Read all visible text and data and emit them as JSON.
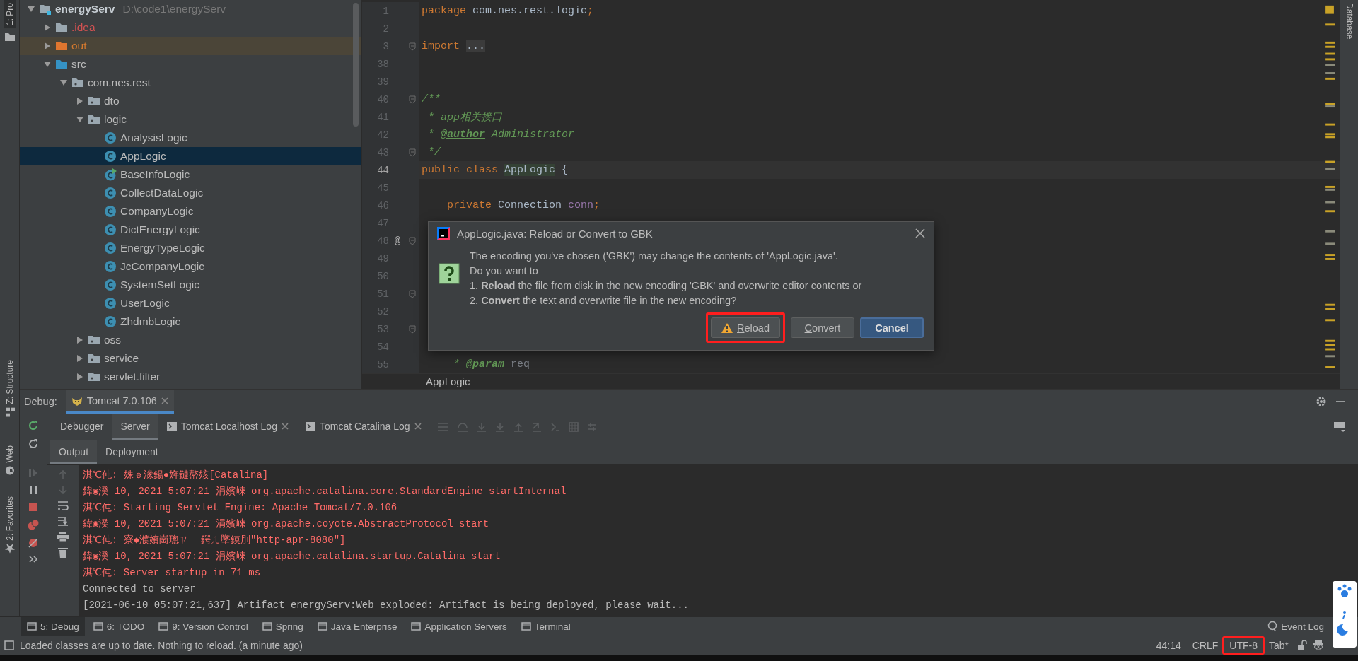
{
  "left_strip": {
    "tabs": [
      {
        "label": "1: Pro",
        "selected": true
      },
      {
        "label": "Z: Structure",
        "selected": false
      },
      {
        "label": "Web",
        "selected": false
      },
      {
        "label": "2: Favorites",
        "selected": false
      }
    ]
  },
  "project_tree": [
    {
      "label": "energyServ",
      "path": "D:\\code1\\energyServ",
      "kind": "module",
      "expanded": true,
      "selected": false,
      "children": [
        {
          "label": ".idea",
          "kind": "idea-folder",
          "expanded": false,
          "selected": false
        },
        {
          "label": "out",
          "kind": "excluded-folder",
          "expanded": false,
          "selected": false
        },
        {
          "label": "src",
          "kind": "source-folder",
          "expanded": true,
          "selected": false,
          "children": [
            {
              "label": "com.nes.rest",
              "kind": "package",
              "expanded": true,
              "selected": false,
              "children": [
                {
                  "label": "dto",
                  "kind": "package",
                  "expanded": false,
                  "selected": false
                },
                {
                  "label": "logic",
                  "kind": "package",
                  "expanded": true,
                  "selected": false,
                  "children": [
                    {
                      "label": "AnalysisLogic",
                      "kind": "class",
                      "selected": false
                    },
                    {
                      "label": "AppLogic",
                      "kind": "class",
                      "selected": true
                    },
                    {
                      "label": "BaseInfoLogic",
                      "kind": "runnable-class",
                      "selected": false
                    },
                    {
                      "label": "CollectDataLogic",
                      "kind": "class",
                      "selected": false
                    },
                    {
                      "label": "CompanyLogic",
                      "kind": "class",
                      "selected": false
                    },
                    {
                      "label": "DictEnergyLogic",
                      "kind": "class",
                      "selected": false
                    },
                    {
                      "label": "EnergyTypeLogic",
                      "kind": "class",
                      "selected": false
                    },
                    {
                      "label": "JcCompanyLogic",
                      "kind": "class",
                      "selected": false
                    },
                    {
                      "label": "SystemSetLogic",
                      "kind": "class",
                      "selected": false
                    },
                    {
                      "label": "UserLogic",
                      "kind": "class",
                      "selected": false
                    },
                    {
                      "label": "ZhdmbLogic",
                      "kind": "class",
                      "selected": false
                    }
                  ]
                },
                {
                  "label": "oss",
                  "kind": "package",
                  "expanded": false,
                  "selected": false
                },
                {
                  "label": "service",
                  "kind": "package",
                  "expanded": false,
                  "selected": false
                },
                {
                  "label": "servlet.filter",
                  "kind": "package",
                  "expanded": false,
                  "selected": false
                }
              ]
            }
          ]
        }
      ]
    }
  ],
  "editor": {
    "lines": [
      {
        "number": "1",
        "current": false,
        "fold": false,
        "tokens": [
          {
            "text": "package ",
            "kind": "keyword"
          },
          {
            "text": "com.nes.rest.logic",
            "kind": "plain"
          },
          {
            "text": ";",
            "kind": "keyword"
          }
        ]
      },
      {
        "number": "2",
        "current": false,
        "fold": false
      },
      {
        "number": "3",
        "current": false,
        "fold": true,
        "tokens": [
          {
            "text": "import ",
            "kind": "keyword"
          },
          {
            "text": "...",
            "kind": "folded"
          }
        ]
      },
      {
        "number": "38",
        "current": false,
        "fold": false
      },
      {
        "number": "39",
        "current": false,
        "fold": false
      },
      {
        "number": "40",
        "current": false,
        "fold": true,
        "tokens": [
          {
            "text": "/**",
            "kind": "comment"
          }
        ]
      },
      {
        "number": "41",
        "current": false,
        "fold": false,
        "tokens": [
          {
            "text": " * app相关接口",
            "kind": "comment"
          }
        ]
      },
      {
        "number": "42",
        "current": false,
        "fold": false,
        "tokens": [
          {
            "text": " * ",
            "kind": "comment"
          },
          {
            "text": "@author",
            "kind": "doc-tag"
          },
          {
            "text": " Administrator",
            "kind": "comment"
          }
        ]
      },
      {
        "number": "43",
        "current": false,
        "fold": true,
        "tokens": [
          {
            "text": " */",
            "kind": "comment"
          }
        ]
      },
      {
        "number": "44",
        "current": true,
        "fold": false,
        "tokens": [
          {
            "text": "public class ",
            "kind": "keyword"
          },
          {
            "text": "AppLogic",
            "kind": "declared"
          },
          {
            "text": " {",
            "kind": "plain"
          }
        ]
      },
      {
        "number": "45",
        "current": false,
        "fold": false
      },
      {
        "number": "46",
        "current": false,
        "fold": false,
        "tokens": [
          {
            "text": "    private ",
            "kind": "keyword"
          },
          {
            "text": "Connection ",
            "kind": "plain"
          },
          {
            "text": "conn",
            "kind": "field"
          },
          {
            "text": ";",
            "kind": "keyword"
          }
        ]
      },
      {
        "number": "47",
        "current": false,
        "fold": false
      },
      {
        "number": "48",
        "current": false,
        "fold": true,
        "marker": "@"
      },
      {
        "number": "49",
        "current": false,
        "fold": false
      },
      {
        "number": "50",
        "current": false,
        "fold": false
      },
      {
        "number": "51",
        "current": false,
        "fold": true
      },
      {
        "number": "52",
        "current": false,
        "fold": false
      },
      {
        "number": "53",
        "current": false,
        "fold": true
      },
      {
        "number": "54",
        "current": false,
        "fold": false
      },
      {
        "number": "55",
        "current": false,
        "fold": false,
        "tokens": [
          {
            "text": "     * ",
            "kind": "comment"
          },
          {
            "text": "@param",
            "kind": "doc-tag"
          },
          {
            "text": " req",
            "kind": "param"
          }
        ]
      }
    ],
    "breadcrumb": "AppLogic"
  },
  "right_strip": {
    "tabs": [
      {
        "label": "Database",
        "selected": false
      }
    ]
  },
  "dialog": {
    "title": "AppLogic.java: Reload or Convert to GBK",
    "message": [
      "The encoding you've chosen ('GBK') may change the contents of 'AppLogic.java'.",
      "Do you want to",
      "1. **Reload** the file from disk in the new encoding 'GBK' and overwrite editor contents or",
      "2. **Convert** the text and overwrite file in the new encoding?"
    ],
    "buttons": [
      {
        "label": "Reload",
        "kind": "warning",
        "mnemonic": true,
        "highlighted": true
      },
      {
        "label": "Convert",
        "kind": "normal",
        "mnemonic": true,
        "highlighted": false
      },
      {
        "label": "Cancel",
        "kind": "primary",
        "mnemonic": false,
        "highlighted": false
      }
    ]
  },
  "debug": {
    "title": "Debug:",
    "sessions": [
      {
        "label": "Tomcat 7.0.106",
        "selected": true
      }
    ],
    "tabs": [
      {
        "label": "Debugger",
        "selected": false,
        "kind": "plain"
      },
      {
        "label": "Server",
        "selected": true,
        "kind": "plain"
      },
      {
        "label": "Tomcat Localhost Log",
        "selected": false,
        "kind": "log"
      },
      {
        "label": "Tomcat Catalina Log",
        "selected": false,
        "kind": "log"
      }
    ],
    "subtabs": [
      {
        "label": "Output",
        "selected": true
      },
      {
        "label": "Deployment",
        "selected": false
      }
    ],
    "console": [
      {
        "text": "淇℃伅: 姝ｅ湪鍚●姩鏈嶅姟[Catalina]",
        "kind": "error"
      },
      {
        "text": "鍏◉湀 10, 2021 5:07:21 涓嬪崍 org.apache.catalina.core.StandardEngine startInternal",
        "kind": "error"
      },
      {
        "text": "淇℃伅: Starting Servlet Engine: Apache Tomcat/7.0.106",
        "kind": "error"
      },
      {
        "text": "鍏◉湀 10, 2021 5:07:21 涓嬪崍 org.apache.coyote.AbstractProtocol start",
        "kind": "error"
      },
      {
        "text": "淇℃伅: 寮◆濮嬪崗璁ㄗ  鍔ㄦ墜鏌刐\"http-apr-8080\"]",
        "kind": "error"
      },
      {
        "text": "鍏◉湀 10, 2021 5:07:21 涓嬪崍 org.apache.catalina.startup.Catalina start",
        "kind": "error"
      },
      {
        "text": "淇℃伅: Server startup in 71 ms",
        "kind": "error"
      },
      {
        "text": "Connected to server",
        "kind": "normal"
      },
      {
        "text": "[2021-06-10 05:07:21,637] Artifact energyServ:Web exploded: Artifact is being deployed, please wait...",
        "kind": "normal"
      }
    ]
  },
  "tool_windows": [
    {
      "label": "5: Debug",
      "selected": true
    },
    {
      "label": "6: TODO",
      "selected": false
    },
    {
      "label": "9: Version Control",
      "selected": false
    },
    {
      "label": "Spring",
      "selected": false
    },
    {
      "label": "Java Enterprise",
      "selected": false
    },
    {
      "label": "Application Servers",
      "selected": false
    },
    {
      "label": "Terminal",
      "selected": false
    }
  ],
  "event_log": "Event Log",
  "status_bar": {
    "message": "Loaded classes are up to date. Nothing to reload. (a minute ago)",
    "items": [
      {
        "text": "44:14",
        "highlighted": false
      },
      {
        "text": "CRLF",
        "highlighted": false
      },
      {
        "text": "UTF-8",
        "highlighted": true
      },
      {
        "text": "Tab*",
        "highlighted": false
      }
    ]
  }
}
